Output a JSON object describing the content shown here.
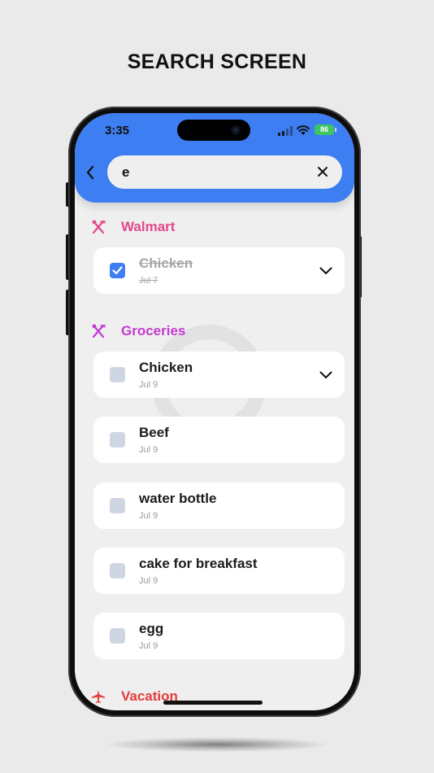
{
  "page": {
    "title": "SEARCH SCREEN"
  },
  "status_bar": {
    "time": "3:35",
    "battery": "86"
  },
  "search": {
    "value": "e",
    "back_icon": "chevron-left-icon",
    "clear_icon": "close-icon"
  },
  "colors": {
    "header": "#3d7ff2",
    "walmart": "#e2488d",
    "groceries": "#c43ad1",
    "vacation": "#e43c3c",
    "checkbox_checked": "#3d7ff2"
  },
  "sections": [
    {
      "name": "Walmart",
      "icon": "utensils-icon",
      "items": [
        {
          "name": "Chicken",
          "date": "Jul 7",
          "checked": true,
          "expandable": true
        }
      ]
    },
    {
      "name": "Groceries",
      "icon": "utensils-icon",
      "items": [
        {
          "name": "Chicken",
          "date": "Jul 9",
          "checked": false,
          "expandable": true
        },
        {
          "name": "Beef",
          "date": "Jul 9",
          "checked": false,
          "expandable": false
        },
        {
          "name": "water bottle",
          "date": "Jul 9",
          "checked": false,
          "expandable": false
        },
        {
          "name": "cake for breakfast",
          "date": "Jul 9",
          "checked": false,
          "expandable": false
        },
        {
          "name": "egg",
          "date": "Jul 9",
          "checked": false,
          "expandable": false
        }
      ]
    },
    {
      "name": "Vacation",
      "icon": "airplane-icon",
      "items": []
    }
  ]
}
